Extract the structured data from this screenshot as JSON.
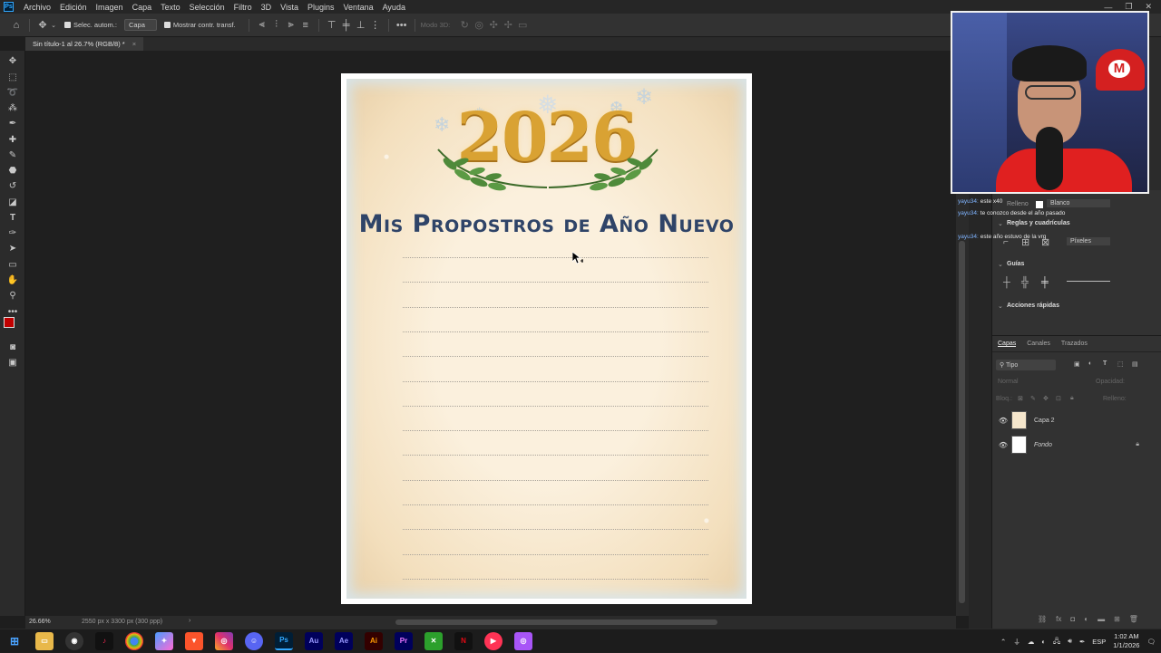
{
  "menubar": {
    "items": [
      "Archivo",
      "Edición",
      "Imagen",
      "Capa",
      "Texto",
      "Selección",
      "Filtro",
      "3D",
      "Vista",
      "Plugins",
      "Ventana",
      "Ayuda"
    ]
  },
  "options": {
    "auto_select_label": "Selec. autom.:",
    "auto_select_value": "Capa",
    "show_transform_label": "Mostrar contr. transf.",
    "mode_3d_label": "Modo 3D:"
  },
  "document": {
    "tab_title": "Sin título-1 al 26.7% (RGB/8) *",
    "year": "2026",
    "heading": "Mis Propostros de Año Nuevo",
    "line_count": 14
  },
  "statusbar": {
    "zoom": "26.66%",
    "doc_info": "2550 px x 3300 px (300 ppp)"
  },
  "properties": {
    "fill_label": "Relleno",
    "fill_value": "Blanco",
    "rulers_label": "Reglas y cuadrículas",
    "units_value": "Píxeles",
    "guides_label": "Guías",
    "quick_actions_label": "Acciones rápidas"
  },
  "layers_panel": {
    "tabs": [
      "Capas",
      "Canales",
      "Trazados"
    ],
    "filter_label": "Tipo",
    "blend_mode": "Normal",
    "opacity_label": "Opacidad:",
    "lock_label": "Bloq.:",
    "fill_label": "Relleno:",
    "layers": [
      {
        "name": "Capa 2"
      },
      {
        "name": "Fondo"
      }
    ]
  },
  "chat": [
    {
      "user": "yayu34:",
      "text": "este x40"
    },
    {
      "user": "yayu34:",
      "text": "te conozco desde el año pasado"
    },
    {
      "user": "yayu34:",
      "text": "este año estuvo de la vrg"
    }
  ],
  "taskbar": {
    "apps": [
      "Au",
      "Ae",
      "Ai",
      "Pr"
    ],
    "lang": "ESP",
    "time": "1:02 AM",
    "date": "1/1/2026"
  },
  "colors": {
    "foreground": "#c00000",
    "background": "#ffffff",
    "title_gold": "#d9a233",
    "heading_navy": "#2f4468"
  }
}
